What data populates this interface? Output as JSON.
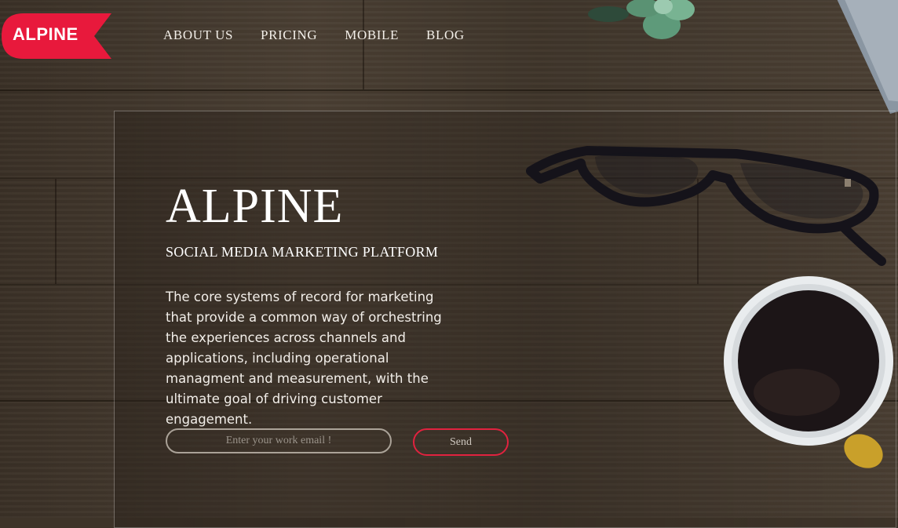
{
  "brand": {
    "logo_text": "ALPINE",
    "accent": "#e8193c"
  },
  "nav": {
    "items": [
      {
        "label": "ABOUT US"
      },
      {
        "label": "PRICING"
      },
      {
        "label": "MOBILE"
      },
      {
        "label": "BLOG"
      }
    ]
  },
  "hero": {
    "title": "ALPINE",
    "subtitle": "SOCIAL MEDIA MARKETING PLATFORM",
    "description": "The core systems of record for marketing that provide a common way of orchestring the experiences across channels and applications, including operational managment and measurement, with the ultimate goal of driving customer engagement.",
    "email_placeholder": "Enter your work email !",
    "send_label": "Send"
  }
}
